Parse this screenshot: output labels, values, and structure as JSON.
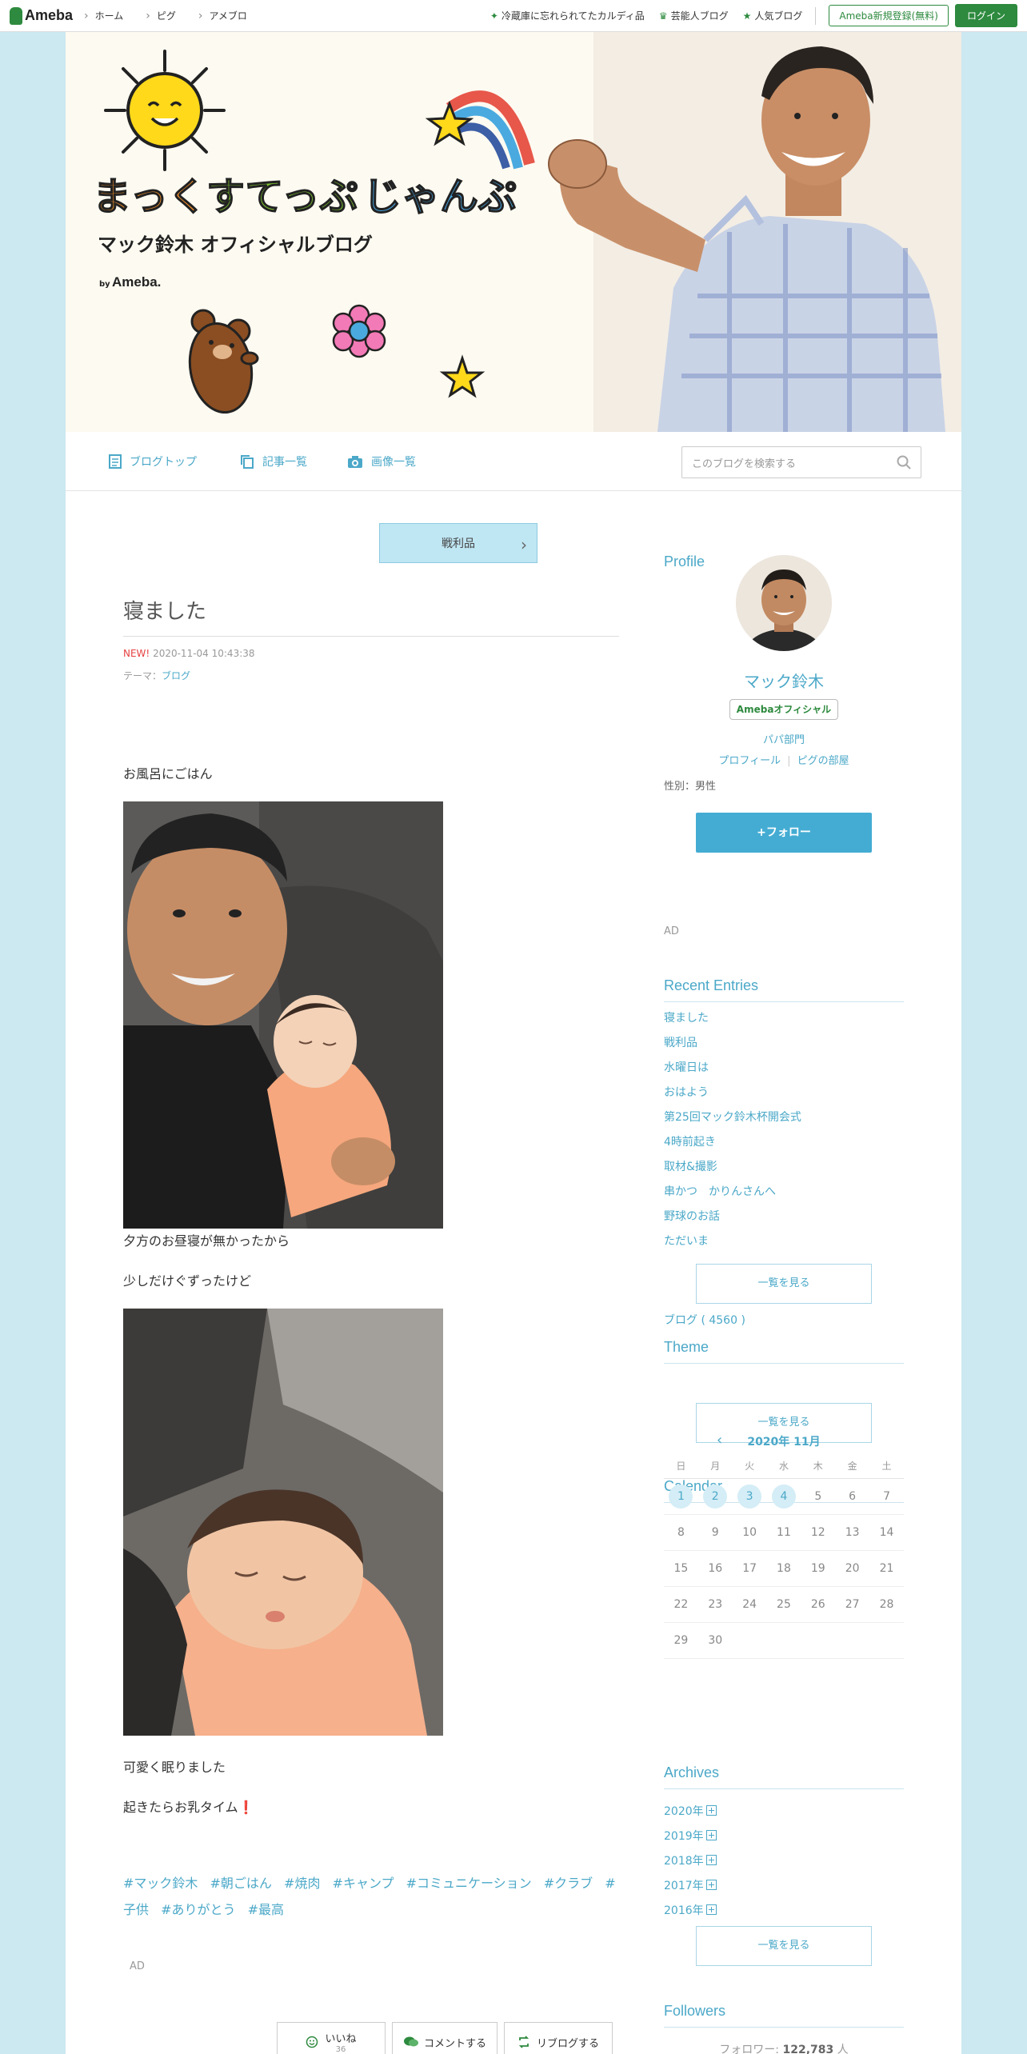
{
  "topbar": {
    "logo": "Ameba",
    "nav": [
      "ホーム",
      "ピグ",
      "アメブロ"
    ],
    "picks": [
      "冷蔵庫に忘れられてたカルディ品",
      "芸能人ブログ",
      "人気ブログ"
    ],
    "register": "Ameba新規登録(無料)",
    "login": "ログイン"
  },
  "header": {
    "title_parts": [
      "まっく",
      "すてっぷ",
      "じゃんぷ"
    ],
    "subtitle": "マック鈴木 オフィシャルブログ",
    "by": "by",
    "by_brand": "Ameba."
  },
  "blognav": {
    "top": "ブログトップ",
    "entries": "記事一覧",
    "images": "画像一覧",
    "search_placeholder": "このブログを検索する"
  },
  "article": {
    "prev": "戦利品",
    "title": "寝ました",
    "new_label": "NEW!",
    "datetime": "2020-11-04 10:43:38",
    "theme_label": "テーマ：",
    "theme": "ブログ",
    "p1": "お風呂にごはん",
    "p2": "夕方のお昼寝が無かったから",
    "p3": "少しだけぐずったけど",
    "p4": "可愛く眠りました",
    "p5": "起きたらお乳タイム",
    "p5_mark": "❗",
    "hashtags": [
      "#マック鈴木",
      "#朝ごはん",
      "#焼肉",
      "#キャンプ",
      "#コミュニケーション",
      "#クラブ",
      "#子供",
      "#ありがとう",
      "#最高"
    ],
    "ad": "AD",
    "like": "いいね",
    "like_count": "36",
    "comment": "コメントする",
    "reblog": "リブログする"
  },
  "sidebar": {
    "profile_h": "Profile",
    "name": "マック鈴木",
    "badge": "Amebaオフィシャル",
    "category": "パパ部門",
    "link_profile": "プロフィール",
    "link_pig": "ピグの部屋",
    "gender": "性別：男性",
    "follow": "+フォロー",
    "ad": "AD",
    "recent_h": "Recent Entries",
    "recent": [
      "寝ました",
      "戦利品",
      "水曜日は",
      "おはよう",
      "第25回マック鈴木杯開会式",
      "4時前起き",
      "取材&撮影",
      "串かつ　かりんさんへ",
      "野球のお話",
      "ただいま"
    ],
    "more": "一覧を見る",
    "theme_h": "Theme",
    "theme_item": "ブログ ( 4560 )",
    "calendar_h": "Calendar",
    "cal_month": "2020年 11月",
    "weekdays": [
      "日",
      "月",
      "火",
      "水",
      "木",
      "金",
      "土"
    ],
    "weeks": [
      [
        "1",
        "2",
        "3",
        "4",
        "5",
        "6",
        "7"
      ],
      [
        "8",
        "9",
        "10",
        "11",
        "12",
        "13",
        "14"
      ],
      [
        "15",
        "16",
        "17",
        "18",
        "19",
        "20",
        "21"
      ],
      [
        "22",
        "23",
        "24",
        "25",
        "26",
        "27",
        "28"
      ],
      [
        "29",
        "30",
        "",
        "",
        "",
        "",
        ""
      ]
    ],
    "posted_days": [
      "1",
      "2",
      "3",
      "4"
    ],
    "archives_h": "Archives",
    "archives": [
      "2020年",
      "2019年",
      "2018年",
      "2017年",
      "2016年"
    ],
    "followers_h": "Followers",
    "followers_label": "フォロワー: ",
    "followers_count": "122,783",
    "followers_unit": " 人"
  },
  "colors": {
    "accent": "#4ba8c8",
    "brand": "#2d8a3e",
    "bg": "#cce8f0"
  }
}
